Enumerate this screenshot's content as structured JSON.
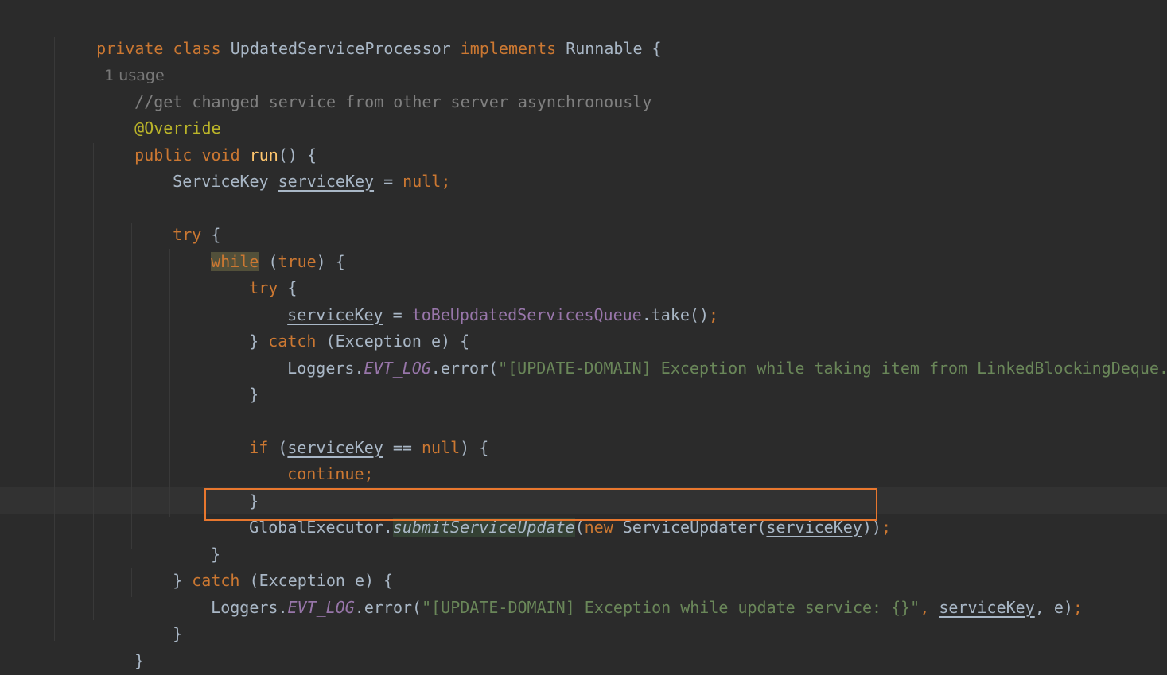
{
  "editor": {
    "usage_hint": "1 usage",
    "lines": {
      "l1": {
        "kw1": "private class ",
        "name": "UpdatedServiceProcessor ",
        "kw2": "implements ",
        "iface": "Runnable {"
      },
      "l3": {
        "comment": "//get changed service from other server asynchronously"
      },
      "l4": {
        "annotation": "@Override"
      },
      "l5": {
        "kw": "public void ",
        "fn": "run",
        "rest": "() {"
      },
      "l6": {
        "type": "ServiceKey ",
        "var": "serviceKey",
        "eq": " = ",
        "null": "null;"
      },
      "l8": {
        "kw": "try",
        "rest": " {"
      },
      "l9": {
        "kw": "while",
        "p1": " (",
        "val": "true",
        "p2": ") {"
      },
      "l10": {
        "kw": "try",
        "rest": " {"
      },
      "l11": {
        "var": "serviceKey",
        "eq": " = ",
        "field": "toBeUpdatedServicesQueue",
        "call": ".take()",
        "semi": ";"
      },
      "l12": {
        "brace": "} ",
        "kw": "catch",
        "rest": " (Exception e) {"
      },
      "l13": {
        "cls": "Loggers.",
        "field": "EVT_LOG",
        "call": ".error(",
        "str": "\"[UPDATE-DOMAIN] Exception while taking item from LinkedBlockingDeque.\"",
        "end": ")",
        "semi": ";"
      },
      "l14": {
        "brace": "}"
      },
      "l16": {
        "kw": "if",
        "p1": " (",
        "var": "serviceKey",
        "op": " == ",
        "null": "null",
        "p2": ") {"
      },
      "l17": {
        "kw": "continue;"
      },
      "l18": {
        "brace": "}"
      },
      "l19": {
        "cls": "GlobalExecutor.",
        "meth": "submitServiceUpdate",
        "p1": "(",
        "kw": "new ",
        "ctor": "ServiceUpdater(",
        "var": "serviceKey",
        "p2": "))",
        "semi": ";"
      },
      "l20": {
        "brace": "}"
      },
      "l21": {
        "brace": "} ",
        "kw": "catch",
        "rest": " (Exception e) {"
      },
      "l22": {
        "cls": "Loggers.",
        "field": "EVT_LOG",
        "call": ".error(",
        "str": "\"[UPDATE-DOMAIN] Exception while update service: {}\"",
        "comma1": ", ",
        "var": "serviceKey",
        "comma2": ", e)",
        "semi": ";"
      },
      "l23": {
        "brace": "}"
      },
      "l24": {
        "brace": "}"
      },
      "l25": {
        "brace": "}"
      }
    }
  },
  "colors": {
    "background": "#2b2b2b",
    "keyword": "#cc7832",
    "text": "#a9b7c6",
    "string": "#6a8759",
    "field": "#9876aa",
    "annotation": "#bbb529",
    "method_decl": "#ffc66d",
    "highlight_box": "#e8772e"
  }
}
